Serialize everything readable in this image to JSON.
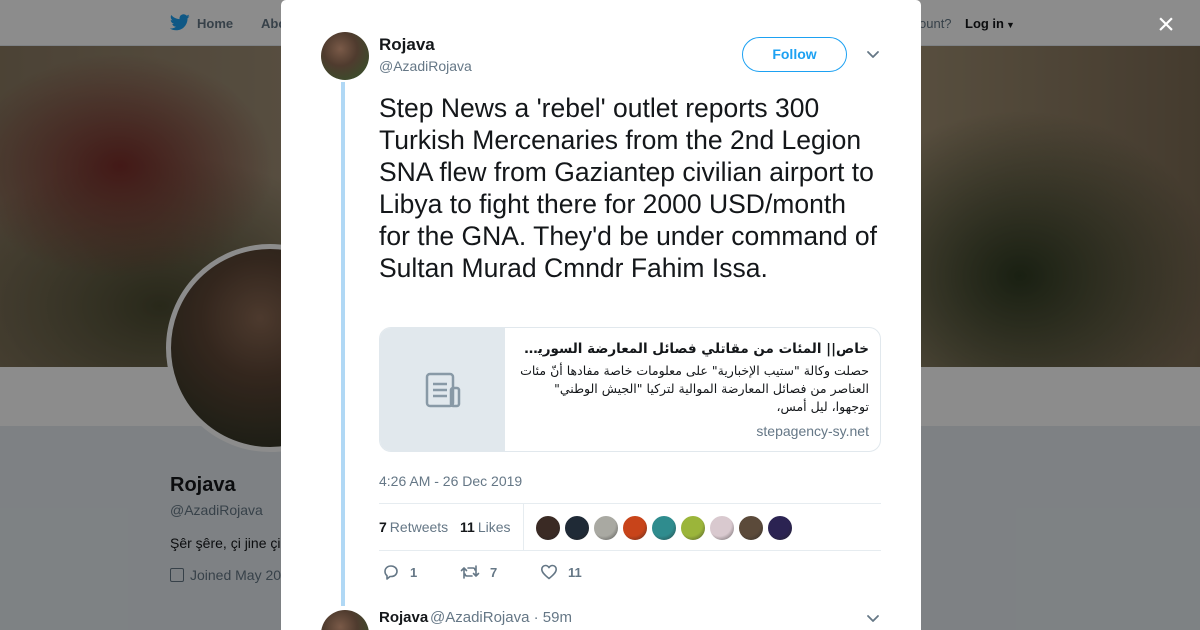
{
  "background": {
    "nav": {
      "home_label": "Home",
      "about_label": "Abo",
      "have_account": "ccount?",
      "login_label": "Log in"
    },
    "profile": {
      "name": "Rojava",
      "handle": "@AzadiRojava",
      "bio": "Şêr şêre, çi jine çi",
      "joined": "Joined May 20"
    }
  },
  "modal": {
    "close_label": "×",
    "author": {
      "name": "Rojava",
      "handle": "@AzadiRojava"
    },
    "follow_label": "Follow",
    "tweet_text": "Step News a 'rebel' outlet reports 300 Turkish Mercenaries from the 2nd Legion SNA flew from Gaziantep civilian airport to Libya to fight there for 2000 USD/month for the GNA. They'd be under command of Sultan Murad Cmndr Fahim Issa.",
    "card": {
      "title": "خاص|| المئات من مقاتلي فصائل المعارضة السورية ...",
      "description": "حصلت وكالة \"ستيب الإخبارية\" على معلومات خاصة مفادها أنّ مئات العناصر من فصائل المعارضة الموالية لتركيا \"الجيش الوطني\" توجهوا، ليل أمس،",
      "domain": "stepagency-sy.net"
    },
    "timestamp": "4:26 AM - 26 Dec 2019",
    "stats": {
      "retweets_count": "7",
      "retweets_label": "Retweets",
      "likes_count": "11",
      "likes_label": "Likes"
    },
    "likers": [
      {
        "name": "liker-avatar-1",
        "color": "#3a2a24"
      },
      {
        "name": "liker-avatar-2",
        "color": "#1f2a36"
      },
      {
        "name": "liker-avatar-3",
        "color": "#a9a9a2"
      },
      {
        "name": "liker-avatar-4",
        "color": "#c8441a"
      },
      {
        "name": "liker-avatar-5",
        "color": "#2f8c8e"
      },
      {
        "name": "liker-avatar-6",
        "color": "#9bb53a"
      },
      {
        "name": "liker-avatar-7",
        "color": "#d9c9cf"
      },
      {
        "name": "liker-avatar-8",
        "color": "#5b4a3a"
      },
      {
        "name": "liker-avatar-9",
        "color": "#2b2352"
      }
    ],
    "actions": {
      "reply_count": "1",
      "retweet_count": "7",
      "like_count": "11"
    },
    "reply": {
      "name": "Rojava",
      "handle_time": "@AzadiRojava · 59m"
    },
    "colors": {
      "accent": "#1da1f2",
      "thread_line": "#b0d8f5",
      "secondary_text": "#657786"
    }
  }
}
